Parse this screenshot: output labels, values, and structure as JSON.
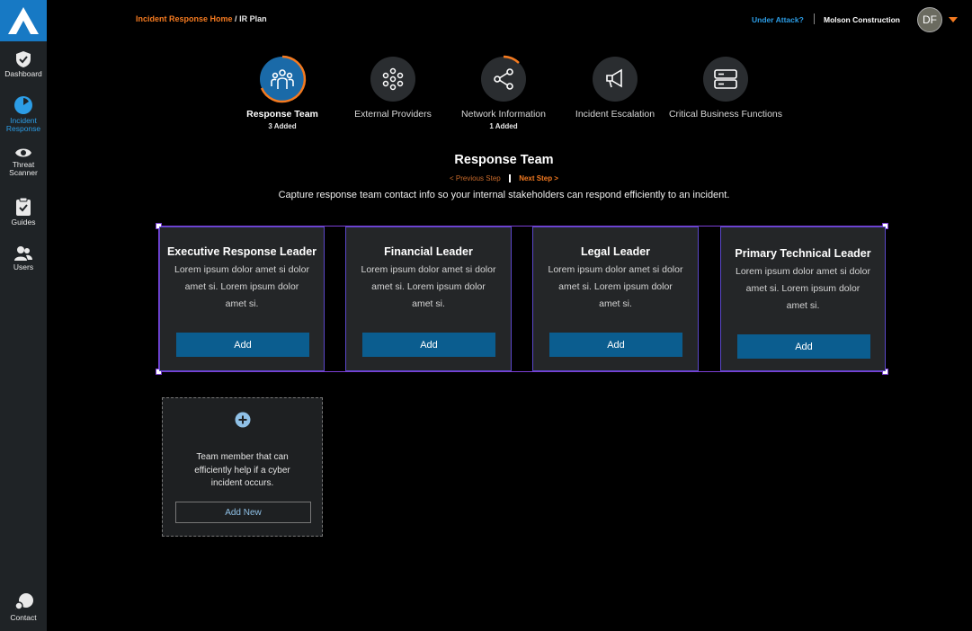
{
  "sidebar": {
    "items": [
      {
        "label_1": "Dashboard",
        "label_2": "",
        "icon": "shield-icon"
      },
      {
        "label_1": "Incident",
        "label_2": "Response",
        "icon": "incident-response-icon",
        "active": true
      },
      {
        "label_1": "Threat",
        "label_2": "Scanner",
        "icon": "eye-icon"
      },
      {
        "label_1": "Guides",
        "label_2": "",
        "icon": "clipboard-icon"
      },
      {
        "label_1": "Users",
        "label_2": "",
        "icon": "users-icon"
      }
    ],
    "contact": {
      "label": "Contact",
      "icon": "chat-icon"
    }
  },
  "header": {
    "breadcrumb_home": "Incident Response Home",
    "breadcrumb_sep": "/",
    "breadcrumb_current": "IR Plan",
    "under_attack": "Under Attack?",
    "company": "Molson Construction",
    "avatar_initials": "DF"
  },
  "steps": [
    {
      "label": "Response Team",
      "sub": "3 Added",
      "icon": "team-icon",
      "active": true
    },
    {
      "label": "External Providers",
      "sub": "",
      "icon": "network-dots-icon"
    },
    {
      "label": "Network Information",
      "sub": "1 Added",
      "icon": "share-icon"
    },
    {
      "label": "Incident Escalation",
      "sub": "",
      "icon": "megaphone-icon"
    },
    {
      "label": "Critical Business Functions",
      "sub": "",
      "icon": "server-icon"
    }
  ],
  "section": {
    "title": "Response Team",
    "prev": "< Previous Step",
    "next": "Next Step >",
    "description": "Capture response team contact info so your internal stakeholders can respond efficiently to an incident."
  },
  "cards": [
    {
      "title": "Executive Response Leader",
      "desc": "Lorem ipsum dolor amet si dolor amet si. Lorem ipsum dolor amet si.",
      "button": "Add"
    },
    {
      "title": "Financial Leader",
      "desc": "Lorem ipsum dolor amet si dolor amet si. Lorem ipsum dolor amet si.",
      "button": "Add"
    },
    {
      "title": "Legal Leader",
      "desc": "Lorem ipsum dolor amet si dolor amet si. Lorem ipsum dolor amet si.",
      "button": "Add"
    },
    {
      "title": "Primary Technical Leader",
      "desc": "Lorem ipsum dolor amet si dolor amet si. Lorem ipsum dolor amet si.",
      "button": "Add"
    }
  ],
  "add_card": {
    "desc": "Team member that can efficiently help if a cyber incident occurs.",
    "button": "Add New",
    "icon": "plus-circle-icon"
  },
  "colors": {
    "accent_orange": "#f47a20",
    "accent_blue": "#2c9de6",
    "button_blue": "#0b5d8f",
    "selection_purple": "#7b3fd6"
  }
}
